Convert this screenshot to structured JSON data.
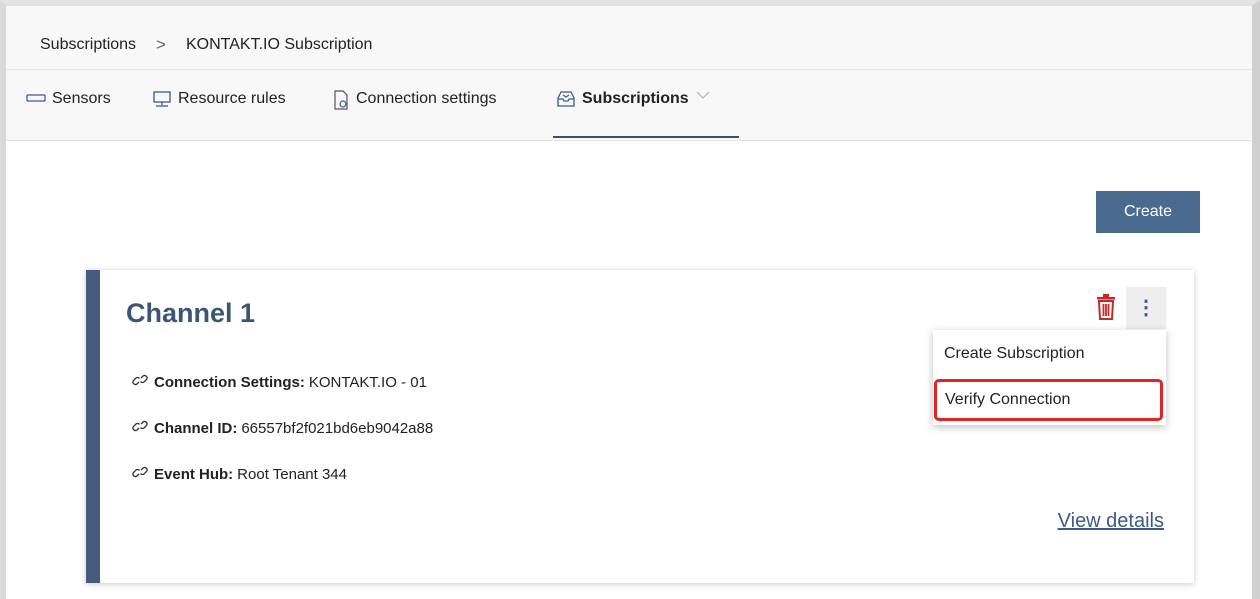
{
  "breadcrumb": {
    "root": "Subscriptions",
    "separator": ">",
    "current": "KONTAKT.IO Subscription"
  },
  "tabs": [
    {
      "label": "Sensors",
      "icon": "sensor-icon",
      "active": false
    },
    {
      "label": "Resource rules",
      "icon": "monitor-icon",
      "active": false
    },
    {
      "label": "Connection settings",
      "icon": "document-gear-icon",
      "active": false
    },
    {
      "label": "Subscriptions",
      "icon": "inbox-icon",
      "active": true
    }
  ],
  "toolbar": {
    "create_label": "Create"
  },
  "card": {
    "title": "Channel 1",
    "fields": [
      {
        "label": "Connection Settings:",
        "value": "KONTAKT.IO - 01",
        "icon": "link-icon"
      },
      {
        "label": "Channel ID:",
        "value": "66557bf2f021bd6eb9042a88",
        "icon": "link-icon"
      },
      {
        "label": "Event Hub:",
        "value": "Root Tenant 344",
        "icon": "link-icon"
      }
    ],
    "view_details_label": "View details",
    "more_label": "⋮"
  },
  "menu": {
    "items": [
      {
        "label": "Create Subscription"
      },
      {
        "label": "Verify Connection"
      }
    ]
  },
  "colors": {
    "accent": "#4a6b8f",
    "card_border": "#475c7a",
    "title": "#3c5575",
    "danger": "#c62828",
    "highlight": "#e02424"
  }
}
